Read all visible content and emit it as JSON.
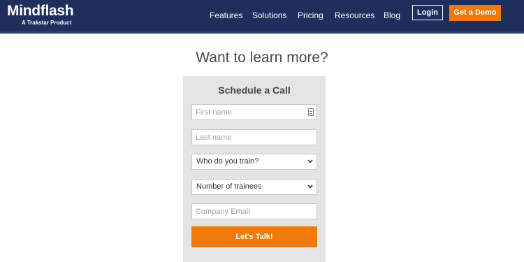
{
  "header": {
    "logo_name": "Mindflash",
    "logo_sub": "A Trakstar Product",
    "nav": [
      "Features",
      "Solutions",
      "Pricing",
      "Resources",
      "Blog"
    ],
    "login_label": "Login",
    "demo_label": "Get a Demo"
  },
  "main": {
    "heading": "Want to learn more?"
  },
  "form": {
    "title": "Schedule a Call",
    "first_name_placeholder": "First name",
    "last_name_placeholder": "Last name",
    "train_select": "Who do you train?",
    "trainees_select": "Number of trainees",
    "email_placeholder": "Company Email",
    "submit_label": "Let's Talk!"
  },
  "colors": {
    "nav_bg": "#1e2f5e",
    "accent": "#ef7a0b",
    "card_bg": "#e4e4e4"
  }
}
